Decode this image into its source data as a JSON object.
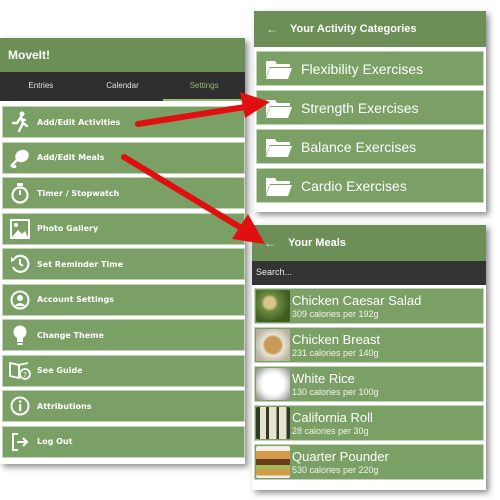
{
  "left": {
    "app_title": "MoveIt!",
    "tabs": [
      {
        "label": "Entries"
      },
      {
        "label": "Calendar"
      },
      {
        "label": "Settings"
      }
    ],
    "menu": [
      {
        "label": "Add/Edit Activities",
        "icon": "runner-icon"
      },
      {
        "label": "Add/Edit Meals",
        "icon": "chicken-leg-icon"
      },
      {
        "label": "Timer / Stopwatch",
        "icon": "stopwatch-icon"
      },
      {
        "label": "Photo Gallery",
        "icon": "photo-icon"
      },
      {
        "label": "Set Reminder Time",
        "icon": "reminder-icon"
      },
      {
        "label": "Account Settings",
        "icon": "account-icon"
      },
      {
        "label": "Change Theme",
        "icon": "lightbulb-icon"
      },
      {
        "label": "See Guide",
        "icon": "guide-icon"
      },
      {
        "label": "Attributions",
        "icon": "info-icon"
      },
      {
        "label": "Log Out",
        "icon": "logout-icon"
      }
    ]
  },
  "activity": {
    "back": "←",
    "title": "Your Activity Categories",
    "categories": [
      {
        "label": "Flexibility Exercises"
      },
      {
        "label": "Strength Exercises"
      },
      {
        "label": "Balance Exercises"
      },
      {
        "label": "Cardio Exercises"
      }
    ]
  },
  "meals": {
    "back": "←",
    "title": "Your Meals",
    "search_placeholder": "Search...",
    "items": [
      {
        "name": "Chicken Caesar Salad",
        "calories": "309 calories per 192g"
      },
      {
        "name": "Chicken Breast",
        "calories": "231 calories per 140g"
      },
      {
        "name": "White Rice",
        "calories": "130 calories per 100g"
      },
      {
        "name": "California Roll",
        "calories": "28 calories per 30g"
      },
      {
        "name": "Quarter Pounder",
        "calories": "530 calories per 220g"
      }
    ]
  },
  "colors": {
    "header_green": "#6b8f57",
    "item_green": "#7ba065",
    "accent_green": "#8fbb72",
    "arrow_red": "#e01010",
    "dark_bar": "#2f2f2f"
  }
}
